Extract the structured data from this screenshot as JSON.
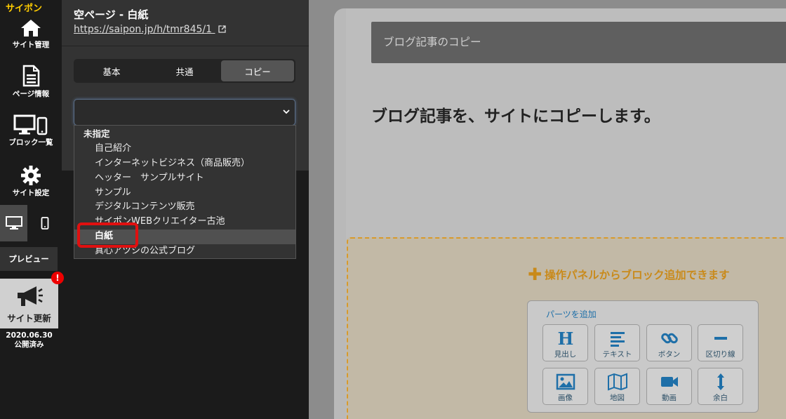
{
  "colors": {
    "accent": "#1e6fa8",
    "warning": "#c98a1a",
    "alert": "#e01010",
    "logo": "#ffcc00"
  },
  "sidebar": {
    "logo": "サイポン",
    "items": [
      {
        "label": "サイト管理",
        "icon": "home-icon"
      },
      {
        "label": "ページ情報",
        "icon": "document-icon"
      },
      {
        "label": "ブロック一覧",
        "icon": "devices-icon"
      },
      {
        "label": "サイト設定",
        "icon": "gear-icon"
      }
    ],
    "preview_label": "プレビュー",
    "update_label": "サイト更新",
    "alert_badge": "!",
    "update_date": "2020.06.30",
    "update_status": "公開済み"
  },
  "panel": {
    "title": "空ページ - 白紙",
    "url": "https://saipon.jp/h/tmr845/1",
    "tabs": [
      {
        "label": "基本"
      },
      {
        "label": "共通"
      },
      {
        "label": "コピー"
      }
    ],
    "select_value": ""
  },
  "dropdown": {
    "group": "未指定",
    "options": [
      "自己紹介",
      "インターネットビジネス（商品販売）",
      "ヘッター　サンプルサイト",
      "サンプル",
      "デジタルコンテンツ販売",
      "サイポンWEBクリエイター古池",
      "白紙",
      "真心アツシの公式ブログ"
    ],
    "selected": "白紙"
  },
  "preview": {
    "copy_header": "ブログ記事のコピー",
    "message": "ブログ記事を、サイトにコピーします。",
    "add_hint": "操作パネルからブロック追加できます",
    "parts_title": "パーツを追加",
    "parts": [
      {
        "label": "見出し",
        "icon": "heading-icon"
      },
      {
        "label": "テキスト",
        "icon": "text-lines-icon"
      },
      {
        "label": "ボタン",
        "icon": "link-icon"
      },
      {
        "label": "区切り線",
        "icon": "divider-icon"
      },
      {
        "label": "画像",
        "icon": "image-icon"
      },
      {
        "label": "地図",
        "icon": "map-icon"
      },
      {
        "label": "動画",
        "icon": "video-icon"
      },
      {
        "label": "余白",
        "icon": "spacing-icon"
      }
    ]
  }
}
